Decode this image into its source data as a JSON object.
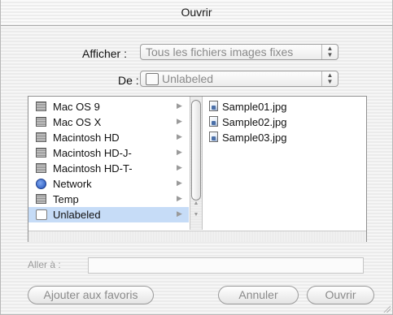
{
  "window": {
    "title": "Ouvrir"
  },
  "show_row": {
    "label": "Afficher :",
    "value": "Tous les fichiers images fixes"
  },
  "from_row": {
    "label": "De :",
    "value": "Unlabeled"
  },
  "volumes": [
    {
      "label": "Mac OS 9",
      "icon": "disk-icon",
      "selected": false
    },
    {
      "label": "Mac OS X",
      "icon": "disk-icon",
      "selected": false
    },
    {
      "label": "Macintosh HD",
      "icon": "disk-icon",
      "selected": false
    },
    {
      "label": "Macintosh HD-J-",
      "icon": "disk-icon",
      "selected": false
    },
    {
      "label": "Macintosh HD-T-",
      "icon": "disk-icon",
      "selected": false
    },
    {
      "label": "Network",
      "icon": "globe-icon",
      "selected": false
    },
    {
      "label": "Temp",
      "icon": "disk-icon",
      "selected": false
    },
    {
      "label": "Unlabeled",
      "icon": "blank-volume-icon",
      "selected": true
    }
  ],
  "files": [
    {
      "label": "Sample01.jpg",
      "icon": "image-file-icon"
    },
    {
      "label": "Sample02.jpg",
      "icon": "image-file-icon"
    },
    {
      "label": "Sample03.jpg",
      "icon": "image-file-icon"
    }
  ],
  "goto": {
    "label": "Aller à :",
    "value": ""
  },
  "buttons": {
    "add_favorites": "Ajouter aux favoris",
    "cancel": "Annuler",
    "open": "Ouvrir"
  },
  "colors": {
    "selection": "#c6dcf7",
    "window_stripe": "#ebebeb"
  }
}
